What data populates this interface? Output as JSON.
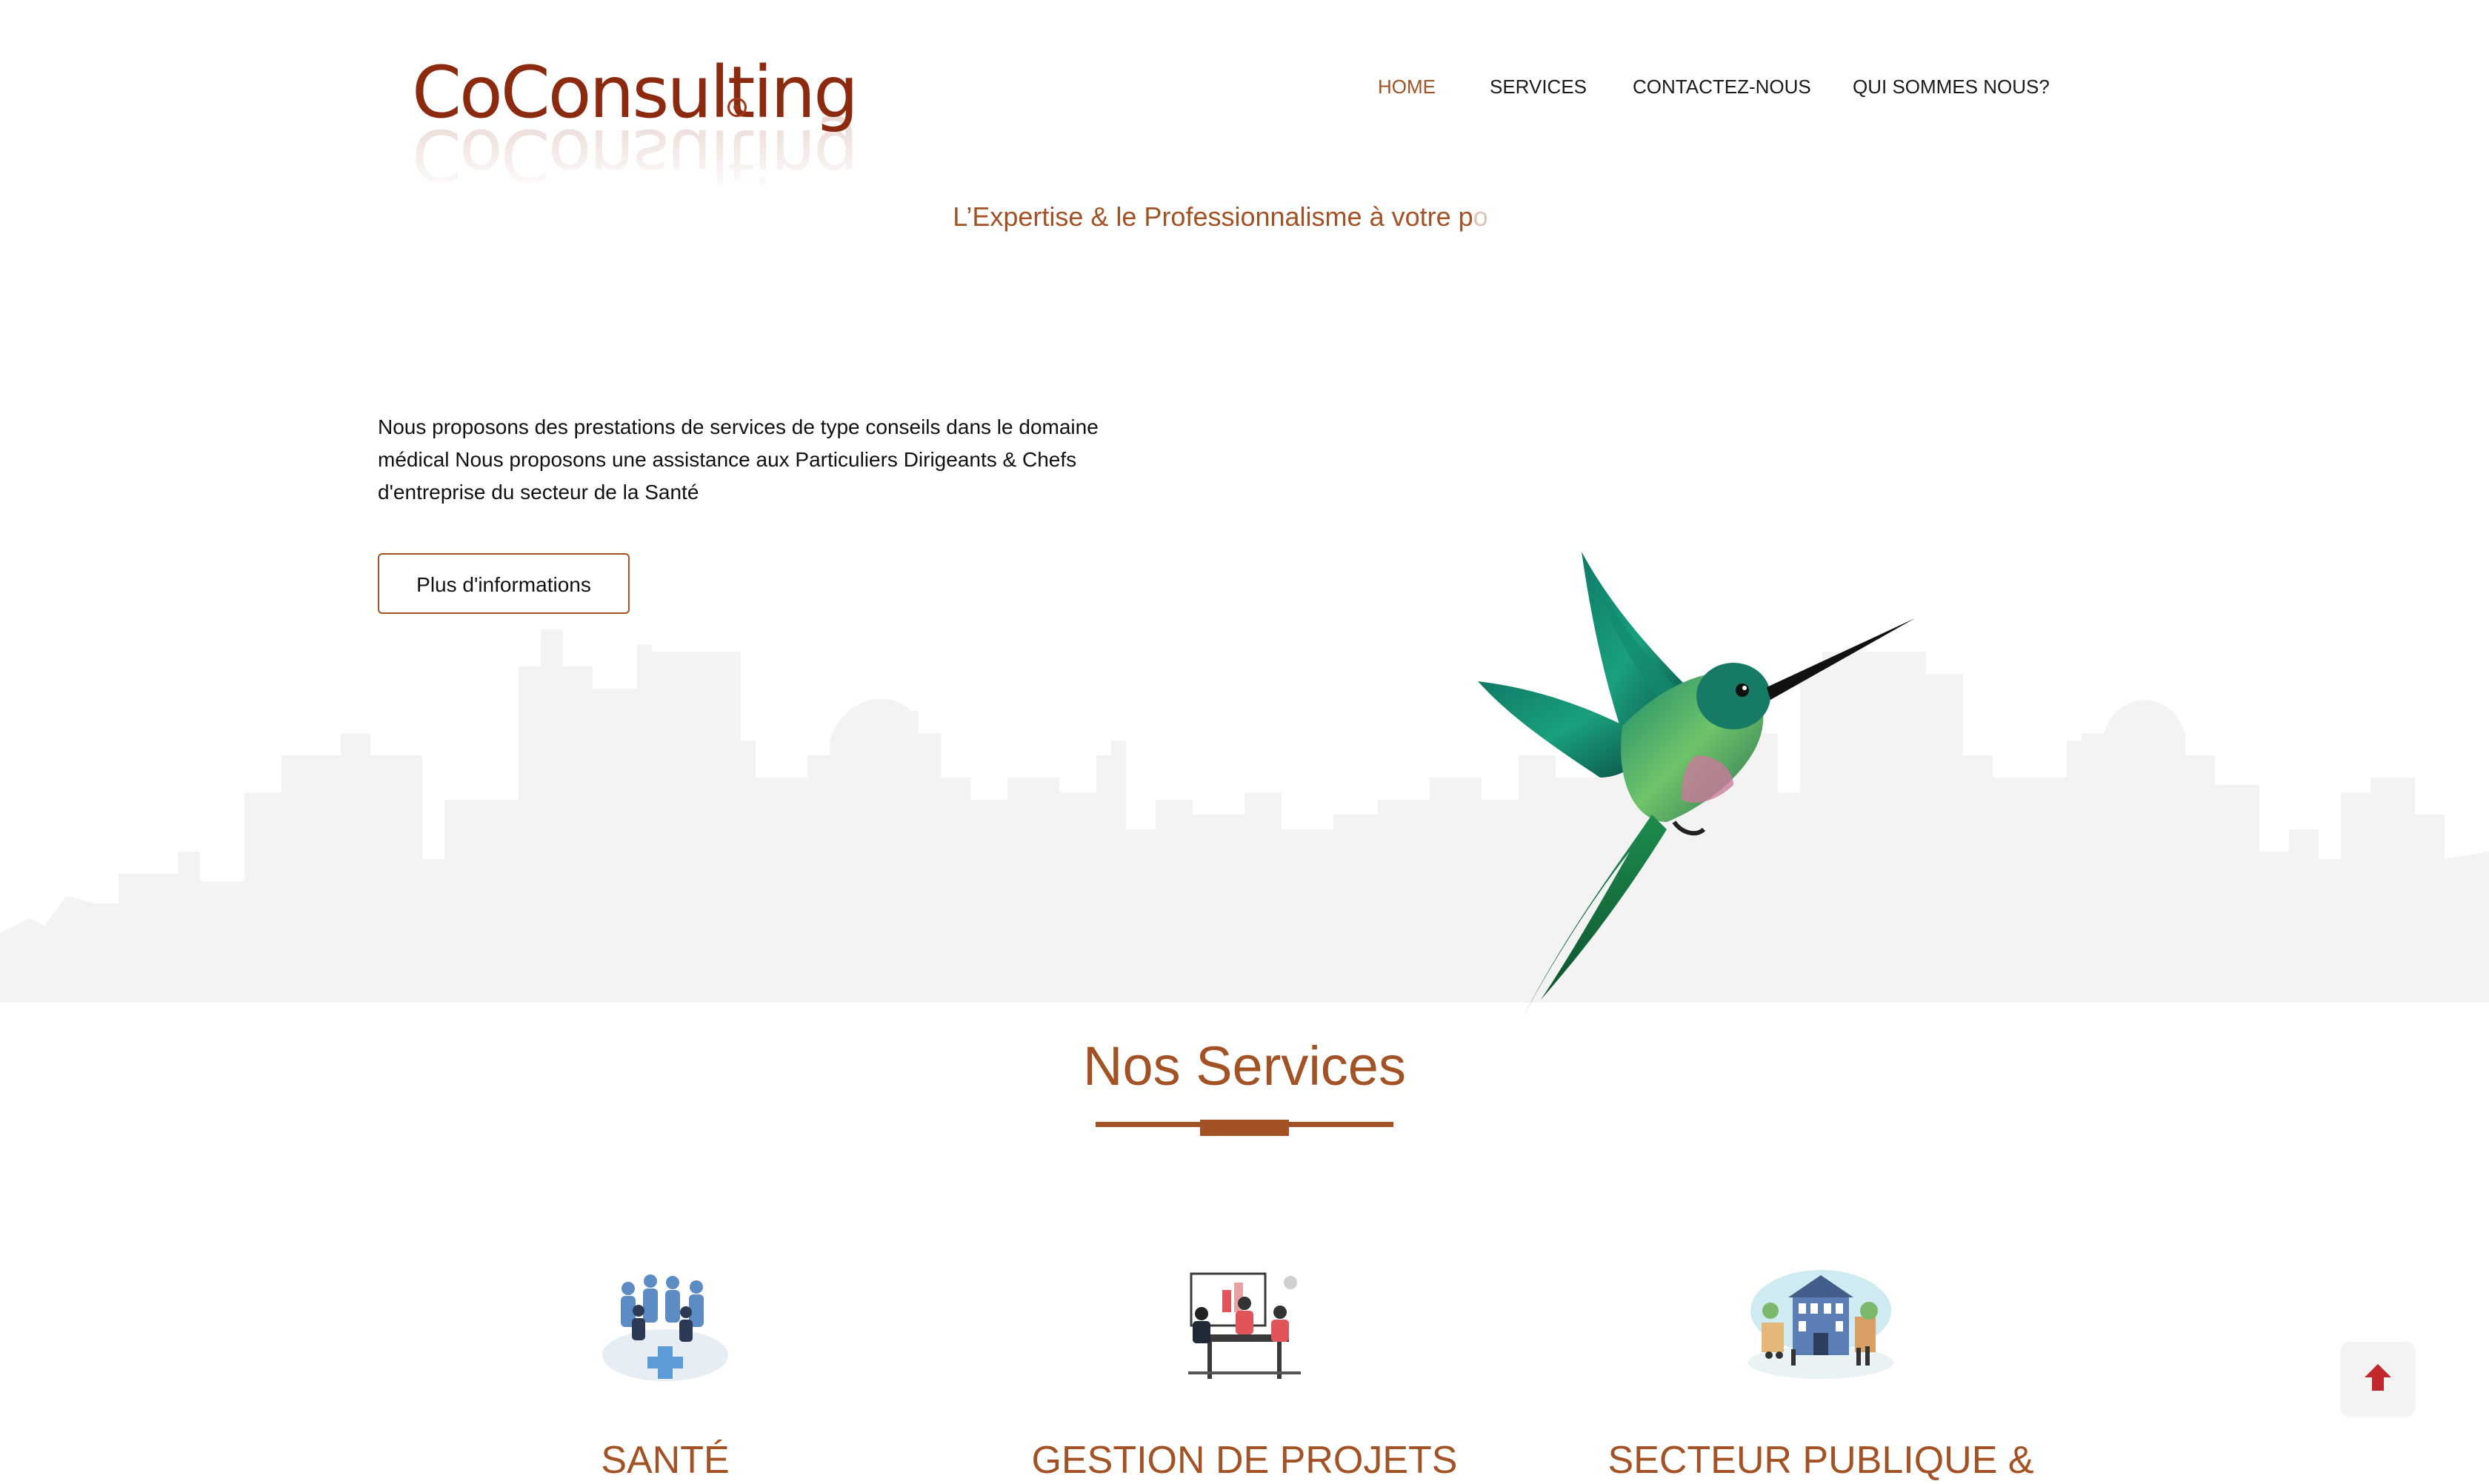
{
  "header": {
    "logo_text": "CoConsulting",
    "logo_reg": "®",
    "nav": [
      {
        "label": "HOME",
        "active": true
      },
      {
        "label": "SERVICES",
        "active": false
      },
      {
        "label": "CONTACTEZ-NOUS",
        "active": false
      },
      {
        "label": "QUI SOMMES NOUS?",
        "active": false
      }
    ],
    "tagline_main": "L’Expertise & le Professionnalisme à votre p",
    "tagline_fade": "o"
  },
  "hero": {
    "description": "Nous proposons des prestations de services de type conseils dans le domaine médical Nous proposons une assistance aux Particuliers Dirigeants & Chefs d'entreprise du secteur de la Santé",
    "button_label": "Plus d'informations"
  },
  "services": {
    "title": "Nos Services",
    "items": [
      {
        "title": "SANTÉ",
        "icon": "medical-team-icon"
      },
      {
        "title": "GESTION DE PROJETS",
        "icon": "meeting-presentation-icon"
      },
      {
        "title": "SECTEUR PUBLIQUE &",
        "icon": "city-hall-icon"
      }
    ]
  },
  "colors": {
    "accent": "#a25224",
    "logo": "#8c2a10",
    "scroll_arrow": "#c0282d",
    "skyline": "#f3f3f3"
  },
  "icons": {
    "scroll_top": "arrow-up-icon",
    "hero_image": "hummingbird-icon"
  }
}
